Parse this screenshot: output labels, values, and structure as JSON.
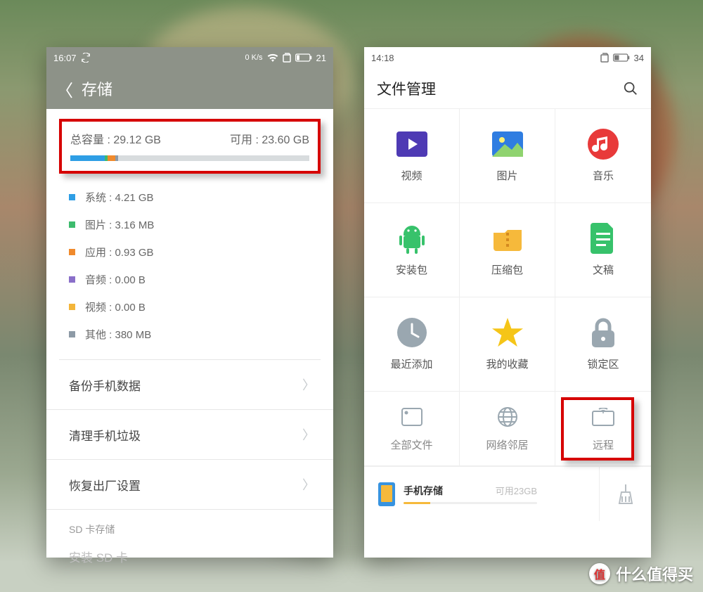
{
  "left": {
    "status": {
      "time": "16:07",
      "speed": "0 K/s",
      "battery": "21"
    },
    "title": "存储",
    "totalLabel": "总容量 : 29.12 GB",
    "availLabel": "可用 : 23.60 GB",
    "bar": [
      {
        "color": "#2e9ee5",
        "pct": 14.5
      },
      {
        "color": "#3dbb6d",
        "pct": 1.0
      },
      {
        "color": "#f08a2c",
        "pct": 3.2
      },
      {
        "color": "#8d9aa6",
        "pct": 1.3
      }
    ],
    "breakdown": [
      {
        "color": "#2e9ee5",
        "label": "系统 : 4.21 GB"
      },
      {
        "color": "#3dbb6d",
        "label": "图片 : 3.16 MB"
      },
      {
        "color": "#f08a2c",
        "label": "应用 : 0.93 GB"
      },
      {
        "color": "#8a6fc9",
        "label": "音频 : 0.00 B"
      },
      {
        "color": "#f3b53a",
        "label": "视频 : 0.00 B"
      },
      {
        "color": "#8d9aa6",
        "label": "其他 : 380 MB"
      }
    ],
    "actions": {
      "backup": "备份手机数据",
      "cleanup": "清理手机垃圾",
      "factory": "恢复出厂设置"
    },
    "sdSection": "SD 卡存储",
    "sdInstall": "安装 SD 卡"
  },
  "right": {
    "status": {
      "time": "14:18",
      "battery": "34"
    },
    "title": "文件管理",
    "tiles": {
      "video": "视频",
      "image": "图片",
      "music": "音乐",
      "apk": "安装包",
      "archive": "压缩包",
      "doc": "文稿",
      "recent": "最近添加",
      "favorite": "我的收藏",
      "locked": "锁定区",
      "allfiles": "全部文件",
      "network": "网络邻居",
      "remote": "远程"
    },
    "storageName": "手机存储",
    "storageAvail": "可用23GB"
  },
  "watermark": "什么值得买"
}
